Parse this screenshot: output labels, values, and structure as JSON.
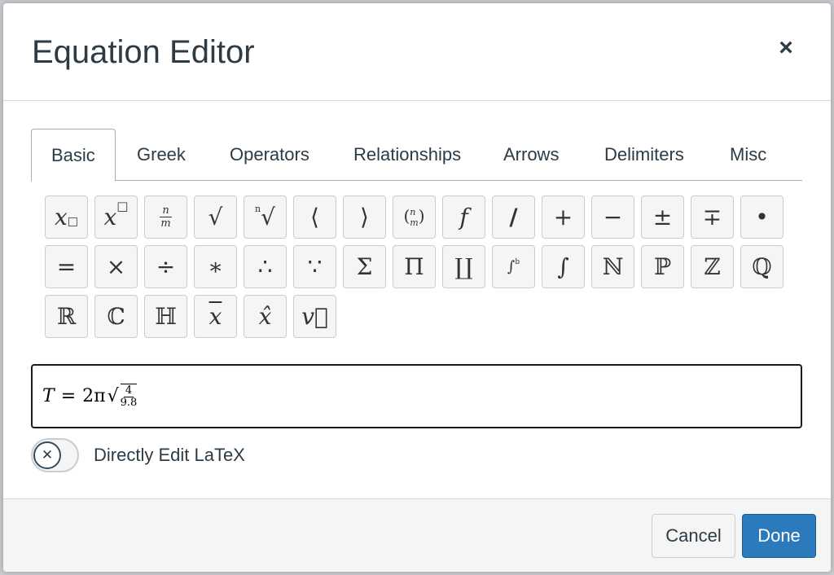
{
  "dialog": {
    "title": "Equation Editor",
    "close_icon": "close-icon"
  },
  "tabs": [
    {
      "label": "Basic",
      "active": true
    },
    {
      "label": "Greek",
      "active": false
    },
    {
      "label": "Operators",
      "active": false
    },
    {
      "label": "Relationships",
      "active": false
    },
    {
      "label": "Arrows",
      "active": false
    },
    {
      "label": "Delimiters",
      "active": false
    },
    {
      "label": "Misc",
      "active": false
    }
  ],
  "symbols": {
    "row1": [
      "x□",
      "x□ sup",
      "n/m",
      "√",
      "ⁿ√",
      "⟨",
      "⟩",
      "(n m)",
      "f",
      "/",
      "+",
      "−",
      "±",
      "∓",
      "•"
    ],
    "row2": [
      "=",
      "×",
      "÷",
      "∗",
      "∴",
      "∵",
      "Σ",
      "Π",
      "∐",
      "∫ab",
      "∫",
      "ℕ",
      "ℙ",
      "ℤ",
      "ℚ"
    ],
    "row3": [
      "ℝ",
      "ℂ",
      "ℍ",
      "x̄",
      "x̂",
      "v⃗"
    ]
  },
  "editor": {
    "lhs": "T",
    "equals": "=",
    "coef": "2π",
    "num": "4",
    "den": "9.8"
  },
  "toggle": {
    "label": "Directly Edit LaTeX",
    "state": "off",
    "knob_icon": "x-icon"
  },
  "footer": {
    "cancel_label": "Cancel",
    "done_label": "Done"
  },
  "colors": {
    "primary": "#2b7abc",
    "text": "#2d3b45",
    "border": "#c7cdd1"
  }
}
